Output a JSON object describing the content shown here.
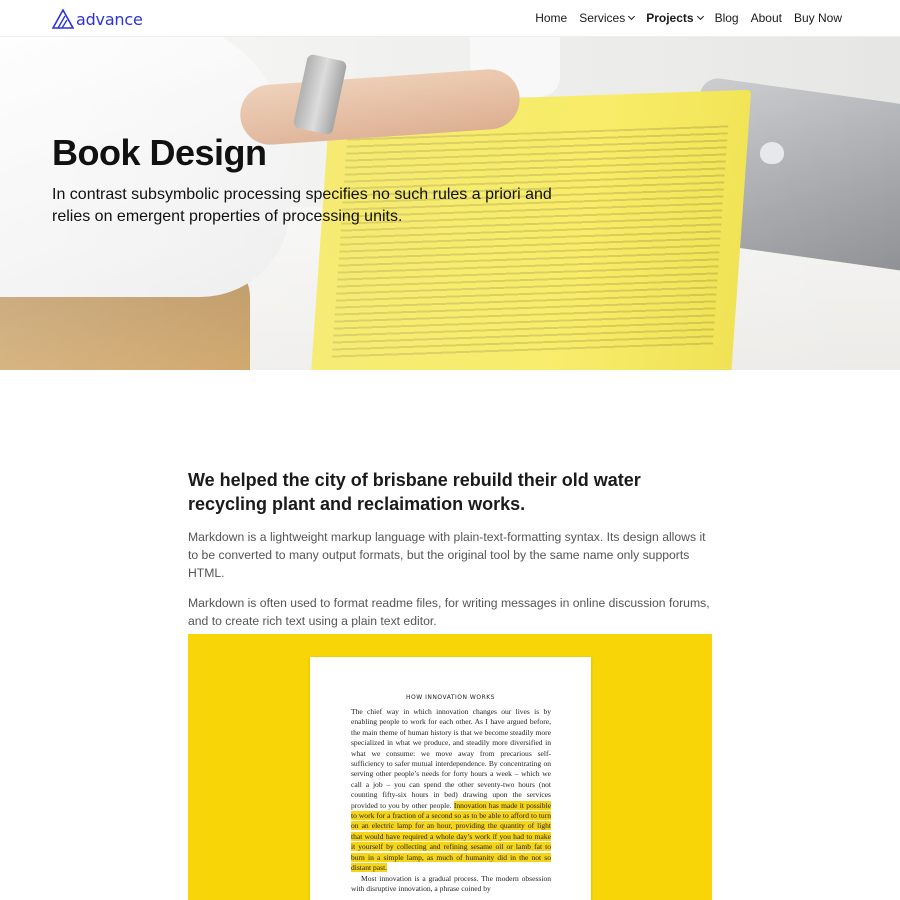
{
  "header": {
    "logo_text": "advance",
    "nav": [
      {
        "label": "Home"
      },
      {
        "label": "Services"
      },
      {
        "label": "Projects"
      },
      {
        "label": "Blog"
      },
      {
        "label": "About"
      },
      {
        "label": "Buy Now"
      }
    ]
  },
  "hero": {
    "title": "Book Design",
    "subtitle": "In contrast subsymbolic processing specifies no such rules a priori and relies on emergent properties of processing units."
  },
  "content": {
    "lead": "We helped the city of brisbane rebuild their old water recycling plant and reclaimation works.",
    "paragraphs": [
      "Markdown is a lightweight markup language with plain-text-formatting syntax. Its design allows it to be converted to many output formats, but the original tool by the same name only supports HTML.",
      "Markdown is often used to format readme files, for writing messages in online discussion forums, and to create rich text using a plain text editor."
    ]
  },
  "figure": {
    "page_title": "HOW INNOVATION WORKS",
    "text_before": "The chief way in which innovation changes our lives is by enabling people to work for each other. As I have argued before, the main theme of human history is that we become steadily more specialized in what we produce, and steadily more diversified in what we consume: we move away from precarious self-sufficiency to safer mutual interdependence. By concentrating on serving other people’s needs for forty hours a week – which we call a job – you can spend the other seventy-two hours (not counting fifty-six hours in bed) drawing upon the services provided to you by other people.",
    "highlighted": "Innovation has made it possible to work for a fraction of a second so as to be able to afford to turn on an electric lamp for an hour, providing the quantity of light that would have required a whole day’s work if you had to make it yourself by collecting and refining sesame oil or lamb fat to burn in a simple lamp, as much of humanity did in the not so distant past.",
    "text_after": "Most innovation is a gradual process. The modern obsession with disruptive innovation, a phrase coined by"
  },
  "colors": {
    "brand": "#2b34d6",
    "figure_background": "#f8d506",
    "highlight": "#f6d418"
  }
}
